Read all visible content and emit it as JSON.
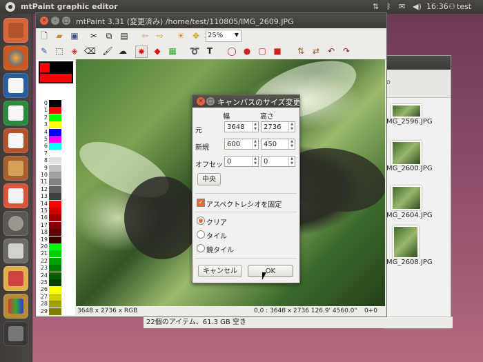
{
  "top_panel": {
    "app_title": "mtPaint graphic editor",
    "time": "16:36",
    "user": "test"
  },
  "launcher": {
    "items": [
      "home-folder",
      "firefox",
      "writer",
      "calc",
      "impress",
      "ubuntu-software",
      "ubuntu-one",
      "gimp",
      "screenshot",
      "inkscape",
      "pencils",
      "workspaces"
    ]
  },
  "window": {
    "title": "mtPaint 3.31 (変更済み) /home/test/110805/IMG_2609.JPG",
    "zoom": "25%",
    "status_left": "3648 x 2736 x RGB",
    "status_right": "0,0 : 3648 x 2736  126.9' 4560.0\"",
    "status_extra": "0+0"
  },
  "palette": {
    "primary_color": "#ff0000",
    "rows": [
      {
        "n": "0",
        "c": "#000000"
      },
      {
        "n": "1",
        "c": "#ff0000"
      },
      {
        "n": "2",
        "c": "#00ff00"
      },
      {
        "n": "3",
        "c": "#ffff00"
      },
      {
        "n": "4",
        "c": "#0000ff"
      },
      {
        "n": "5",
        "c": "#ff00ff"
      },
      {
        "n": "6",
        "c": "#00ffff"
      },
      {
        "n": "7",
        "c": "#ffffff"
      },
      {
        "n": "8",
        "c": "#e0e0e0"
      },
      {
        "n": "9",
        "c": "#c0c0c0"
      },
      {
        "n": "10",
        "c": "#a0a0a0"
      },
      {
        "n": "11",
        "c": "#808080"
      },
      {
        "n": "12",
        "c": "#606060"
      },
      {
        "n": "13",
        "c": "#404040"
      },
      {
        "n": "14",
        "c": "#ff0000"
      },
      {
        "n": "15",
        "c": "#d00000"
      },
      {
        "n": "16",
        "c": "#a00000"
      },
      {
        "n": "17",
        "c": "#800000"
      },
      {
        "n": "18",
        "c": "#600000"
      },
      {
        "n": "19",
        "c": "#400000"
      },
      {
        "n": "20",
        "c": "#00ff00"
      },
      {
        "n": "21",
        "c": "#00d000"
      },
      {
        "n": "22",
        "c": "#00a000"
      },
      {
        "n": "23",
        "c": "#008000"
      },
      {
        "n": "24",
        "c": "#006000"
      },
      {
        "n": "25",
        "c": "#004000"
      },
      {
        "n": "26",
        "c": "#ffff00"
      },
      {
        "n": "27",
        "c": "#d0d000"
      },
      {
        "n": "28",
        "c": "#a0a000"
      },
      {
        "n": "29",
        "c": "#808000"
      }
    ]
  },
  "file_manager": {
    "items": [
      "IMG_2596.JPG",
      "IMG_2600.JPG",
      "IMG_2604.JPG",
      "IMG_2608.JPG"
    ],
    "status": "22個のアイテム、61.3 GB 空き"
  },
  "dialog": {
    "title": "キャンバスのサイズ変更",
    "col_width": "幅",
    "col_height": "高さ",
    "row_original": "元",
    "row_new": "新規",
    "row_offset": "オフセット",
    "orig_w": "3648",
    "orig_h": "2736",
    "new_w": "600",
    "new_h": "450",
    "off_x": "0",
    "off_y": "0",
    "center_label": "中央",
    "aspect_label": "アスペクトレシオを固定",
    "radio_clear": "クリア",
    "radio_tile": "タイル",
    "radio_mirror": "鏡タイル",
    "cancel_label": "キャンセル",
    "ok_label": "OK"
  }
}
